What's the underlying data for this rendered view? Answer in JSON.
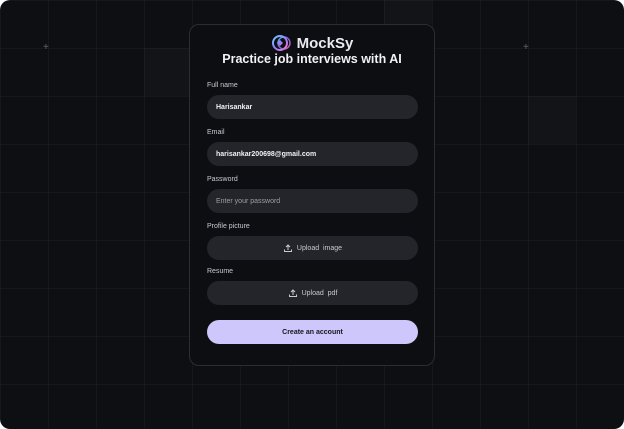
{
  "brand": {
    "name": "MockSy",
    "tagline": "Practice job interviews with AI"
  },
  "form": {
    "full_name": {
      "label": "Full name",
      "value": "Harisankar"
    },
    "email": {
      "label": "Email",
      "value": "harisankar200698@gmail.com"
    },
    "password": {
      "label": "Password",
      "placeholder": "Enter your password"
    },
    "profile_picture": {
      "label": "Profile picture",
      "button": "Upload  image"
    },
    "resume": {
      "label": "Resume",
      "button": "Upload  pdf"
    },
    "submit_label": "Create an account"
  },
  "colors": {
    "background": "#0e0f13",
    "card": "#0d0e12",
    "field": "#24252b",
    "accent": "#cdc7fb"
  }
}
